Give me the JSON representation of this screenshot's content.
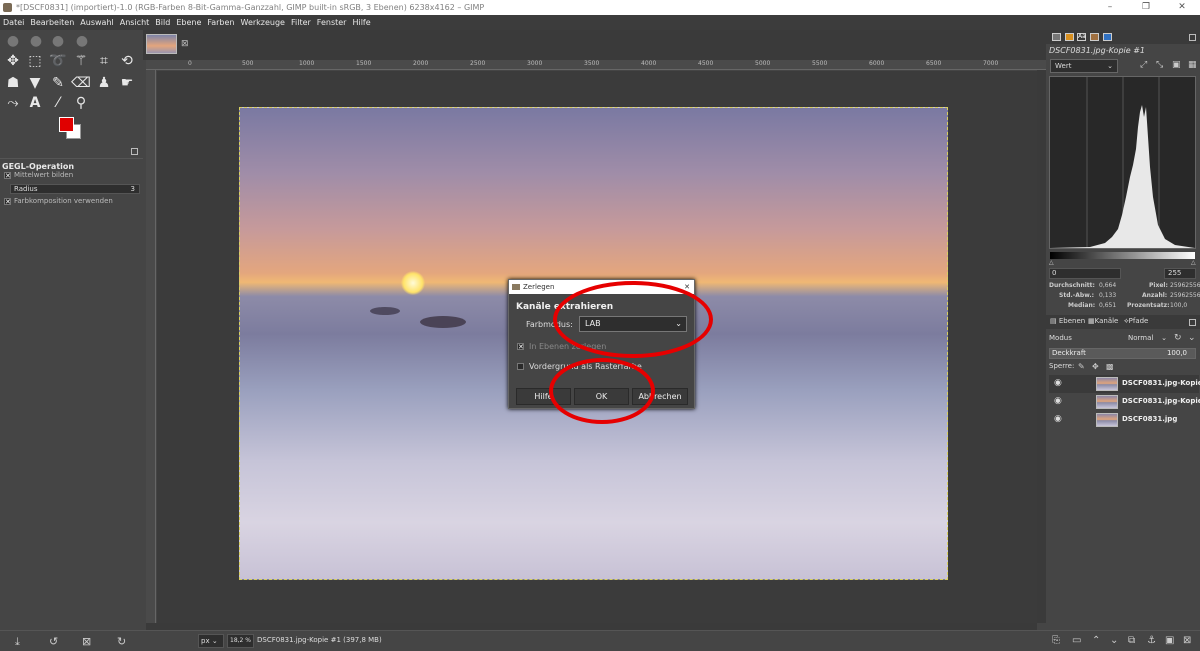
{
  "window": {
    "title": "*[DSCF0831] (importiert)-1.0 (RGB-Farben 8-Bit-Gamma-Ganzzahl, GIMP built-in sRGB, 3 Ebenen) 6238x4162 – GIMP",
    "minimize": "–",
    "maximize": "❐",
    "close": "✕"
  },
  "menu": [
    "Datei",
    "Bearbeiten",
    "Auswahl",
    "Ansicht",
    "Bild",
    "Ebene",
    "Farben",
    "Werkzeuge",
    "Filter",
    "Fenster",
    "Hilfe"
  ],
  "tool_options": {
    "header": "GEGL-Operation",
    "opt1": "Mittelwert bilden",
    "radius_label": "Radius",
    "radius_value": "3",
    "opt2": "Farbkomposition verwenden"
  },
  "ruler_labels": [
    "0",
    "500",
    "1000",
    "1500",
    "2000",
    "2500",
    "3000",
    "3500",
    "4000",
    "4500",
    "5000",
    "5500",
    "6000",
    "6500",
    "7000"
  ],
  "status": {
    "unit": "px",
    "zoom": "18,2 %",
    "info": "DSCF0831.jpg-Kopie #1 (397,8 MB)"
  },
  "dialog": {
    "window_title": "Zerlegen",
    "close": "✕",
    "heading": "Kanäle extrahieren",
    "color_mode_label": "Farbmodus:",
    "color_mode_value": "LAB",
    "option_layers": "In Ebenen zerlegen",
    "option_foreground": "Vordergrund als Rasterfarbe",
    "help_button": "Hilfe",
    "ok_button": "OK",
    "cancel_button": "Abbrechen"
  },
  "histogram": {
    "image_name": "DSCF0831.jpg-Kopie #1",
    "channel": "Wert",
    "range_min": "0",
    "range_max": "255",
    "stats_left": [
      {
        "label": "Durchschnitt:",
        "value": "0,664"
      },
      {
        "label": "Std.-Abw.:",
        "value": "0,133"
      },
      {
        "label": "Median:",
        "value": "0,651"
      }
    ],
    "stats_right": [
      {
        "label": "Pixel:",
        "value": "25962556"
      },
      {
        "label": "Anzahl:",
        "value": "25962556"
      },
      {
        "label": "Prozentsatz:",
        "value": "100,0"
      }
    ]
  },
  "layers_panel": {
    "tabs": [
      "Ebenen",
      "Kanäle",
      "Pfade"
    ],
    "mode_label": "Modus",
    "mode_value": "Normal",
    "opacity_label": "Deckkraft",
    "opacity_value": "100,0",
    "lock_label": "Sperre:",
    "layers": [
      {
        "name": "DSCF0831.jpg-Kopie #1"
      },
      {
        "name": "DSCF0831.jpg-Kopie"
      },
      {
        "name": "DSCF0831.jpg"
      }
    ]
  },
  "colors": {
    "foreground": "#e00000",
    "background": "#ffffff",
    "annotation_ring": "#e60000"
  }
}
